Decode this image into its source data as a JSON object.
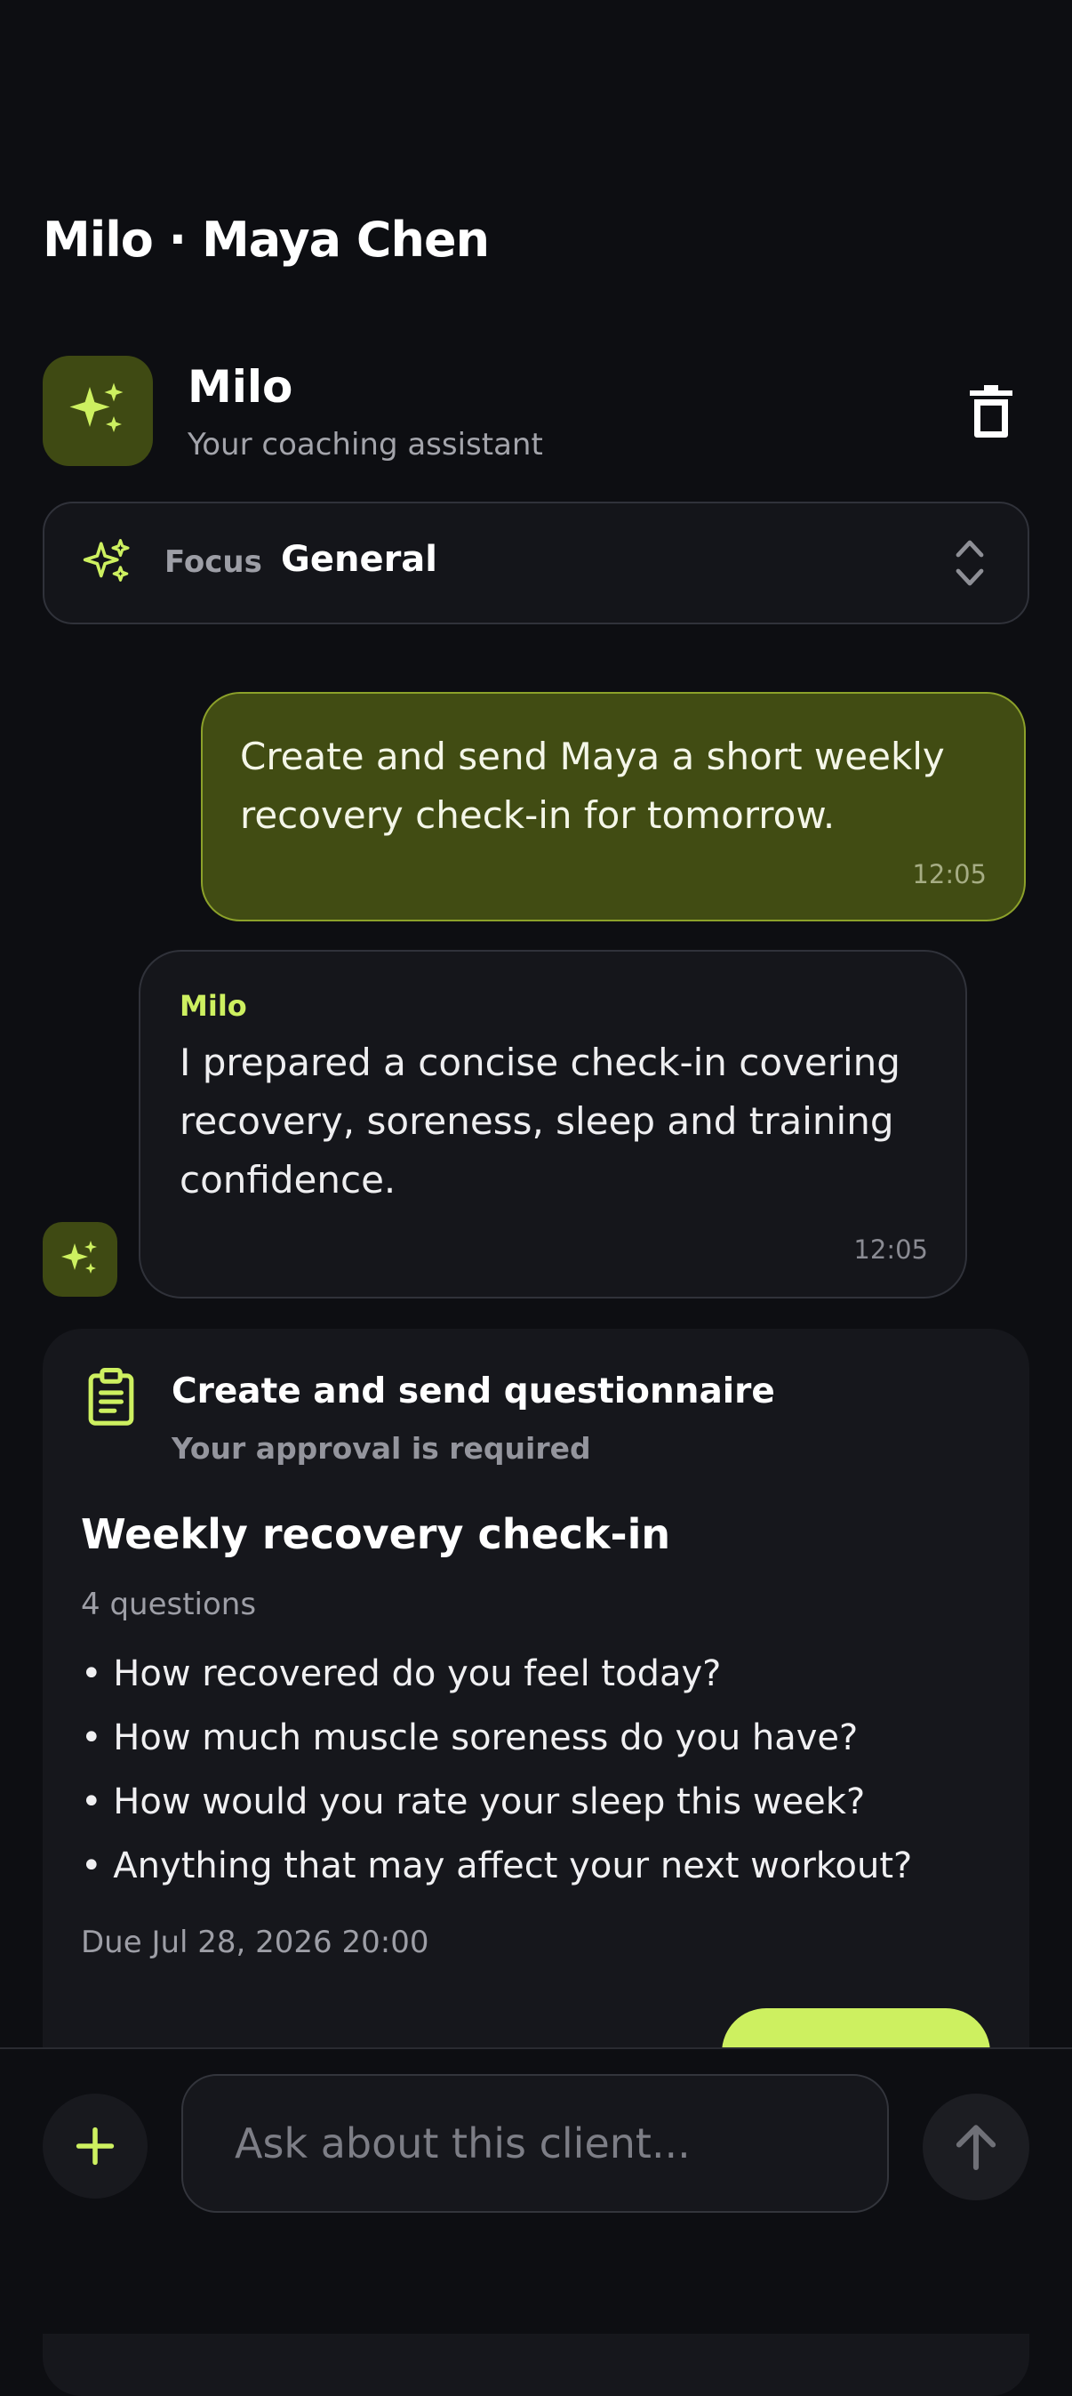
{
  "page": {
    "title": "Milo · Maya Chen"
  },
  "assistant": {
    "name": "Milo",
    "subtitle": "Your coaching assistant",
    "avatar_icon": "sparkles-icon",
    "delete_icon": "trash-icon"
  },
  "focus": {
    "label": "Focus",
    "value": "General",
    "icon": "sparkles-icon",
    "chevron_icon": "chevron-up-down-icon"
  },
  "messages": [
    {
      "sender": "user",
      "text": "Create and send Maya a short weekly recovery check-in for tomorrow.",
      "time": "12:05"
    },
    {
      "sender": "Milo",
      "text": "I prepared a concise check-in covering recovery, soreness, sleep and training confidence.",
      "time": "12:05"
    }
  ],
  "action_card": {
    "icon": "clipboard-icon",
    "title": "Create and send questionnaire",
    "subtitle": "Your approval is required",
    "questionnaire_title": "Weekly recovery check-in",
    "question_count": "4 questions",
    "questions": [
      "• How recovered do you feel today?",
      "• How much muscle soreness do you have?",
      "• How would you rate your sleep this week?",
      "• Anything that may affect your next workout?"
    ],
    "due": "Due Jul 28, 2026 20:00"
  },
  "composer": {
    "placeholder": "Ask about this client...",
    "plus_icon": "plus-icon",
    "send_icon": "arrow-up-icon"
  },
  "colors": {
    "background": "#0d0e12",
    "accent": "#cdf060",
    "user_bubble": "#414c13",
    "card": "#16171c"
  }
}
